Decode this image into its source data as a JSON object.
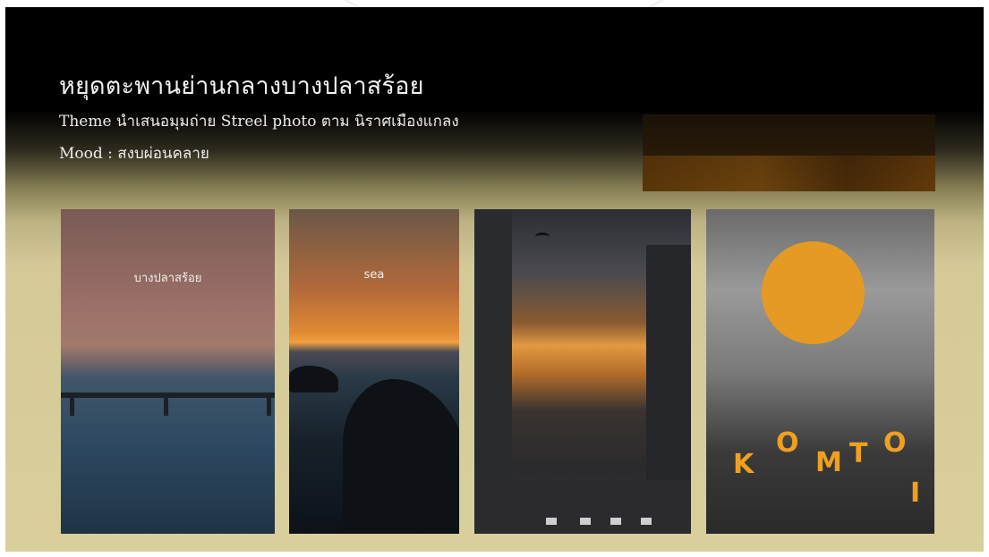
{
  "slide": {
    "title": "หยุดตะพานย่านกลางบางปลาสร้อย",
    "subtitle": "Theme นำเสนอมุมถ่าย Streel photo ตาม นิราศเมืองแกลง",
    "mood": "Mood : สงบผ่อนคลาย"
  },
  "photos": [
    {
      "label": "บางปลาสร้อย"
    },
    {
      "label": "sea"
    },
    {
      "label": ""
    },
    {
      "letters": [
        "K",
        "O",
        "M",
        "T",
        "O",
        "I"
      ]
    }
  ]
}
